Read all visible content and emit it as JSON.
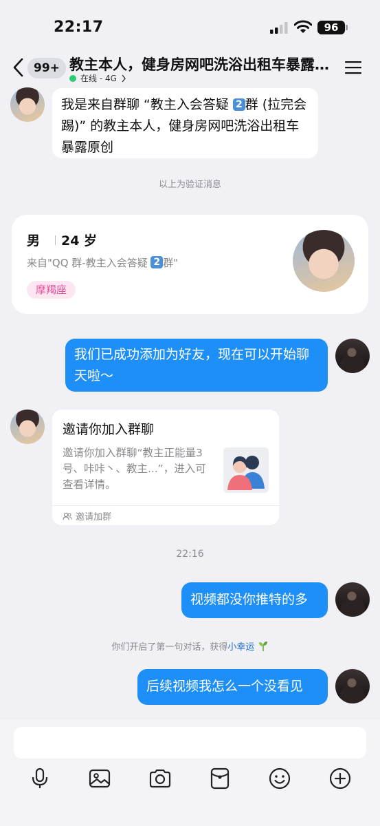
{
  "status_bar": {
    "time": "22:17",
    "battery": "96"
  },
  "header": {
    "unread_count": "99+",
    "title": "教主本人，健身房网吧洗浴出租车暴露原创",
    "online_status": "在线 - 4G"
  },
  "messages": {
    "verify_msg_part1": "我是来自群聊 “教主入会答疑 ",
    "verify_msg_num": "2",
    "verify_msg_part2": "群 (拉完会踢)” 的教主本人，健身房网吧洗浴出租车暴露原创",
    "verify_note": "以上为验证消息",
    "added_friend": "我们已成功添加为好友，现在可以开始聊天啦～",
    "time_divider": "22:16",
    "msg_video_compare": "视频都没你推特的多",
    "luck_note_prefix": "你们开启了第一句对话，获得",
    "luck_note_link": "小幸运",
    "msg_no_videos": "后续视频我怎么一个没看见"
  },
  "profile_card": {
    "gender": "男",
    "age": "24 岁",
    "from_prefix": "来自\"QQ 群-教主入会答疑 ",
    "from_num": "2",
    "from_suffix": "群\"",
    "zodiac": "摩羯座"
  },
  "invite_card": {
    "title": "邀请你加入群聊",
    "description": "邀请你加入群聊“教主正能量3号、咔咔丶、教主...”，进入可查看详情。",
    "footer": "邀请加群"
  },
  "colors": {
    "accent_blue": "#1e8ff6",
    "online_green": "#2ecc71",
    "zodiac_pink": "#e7519a"
  },
  "icons": [
    "back-icon",
    "menu-icon",
    "microphone-icon",
    "image-icon",
    "camera-icon",
    "red-packet-icon",
    "emoji-icon",
    "plus-icon",
    "sprout-icon",
    "group-icon"
  ]
}
